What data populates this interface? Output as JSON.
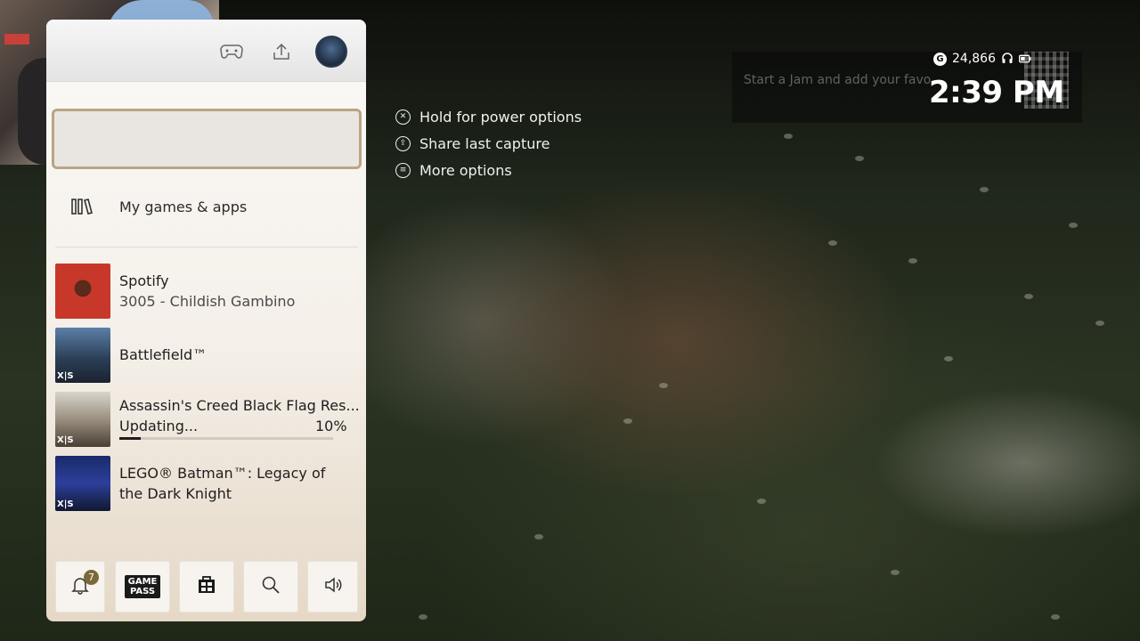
{
  "status": {
    "gamerscore": "24,866",
    "time": "2:39 PM"
  },
  "jam": {
    "text": "Start a Jam and add your favo"
  },
  "hints": [
    {
      "icon": "xbox-button-icon",
      "label": "Hold for power options"
    },
    {
      "icon": "share-button-icon",
      "label": "Share last capture"
    },
    {
      "icon": "menu-button-icon",
      "label": "More options"
    }
  ],
  "guide": {
    "menu_item": "My games & apps",
    "recents": [
      {
        "title": "Spotify",
        "subtitle": "3005 - Childish Gambino"
      },
      {
        "title": "Battlefield™",
        "badge": "X|S"
      },
      {
        "title": "Assassin's Creed Black Flag Res...",
        "status": "Updating...",
        "progress_label": "10%",
        "progress": 0.1,
        "badge": "X|S"
      },
      {
        "title_line1": "LEGO® Batman™: Legacy of",
        "title_line2": "the Dark Knight",
        "badge": "X|S"
      }
    ],
    "bottom": {
      "notification_count": "7",
      "gamepass_line1": "GAME",
      "gamepass_line2": "PASS"
    }
  }
}
